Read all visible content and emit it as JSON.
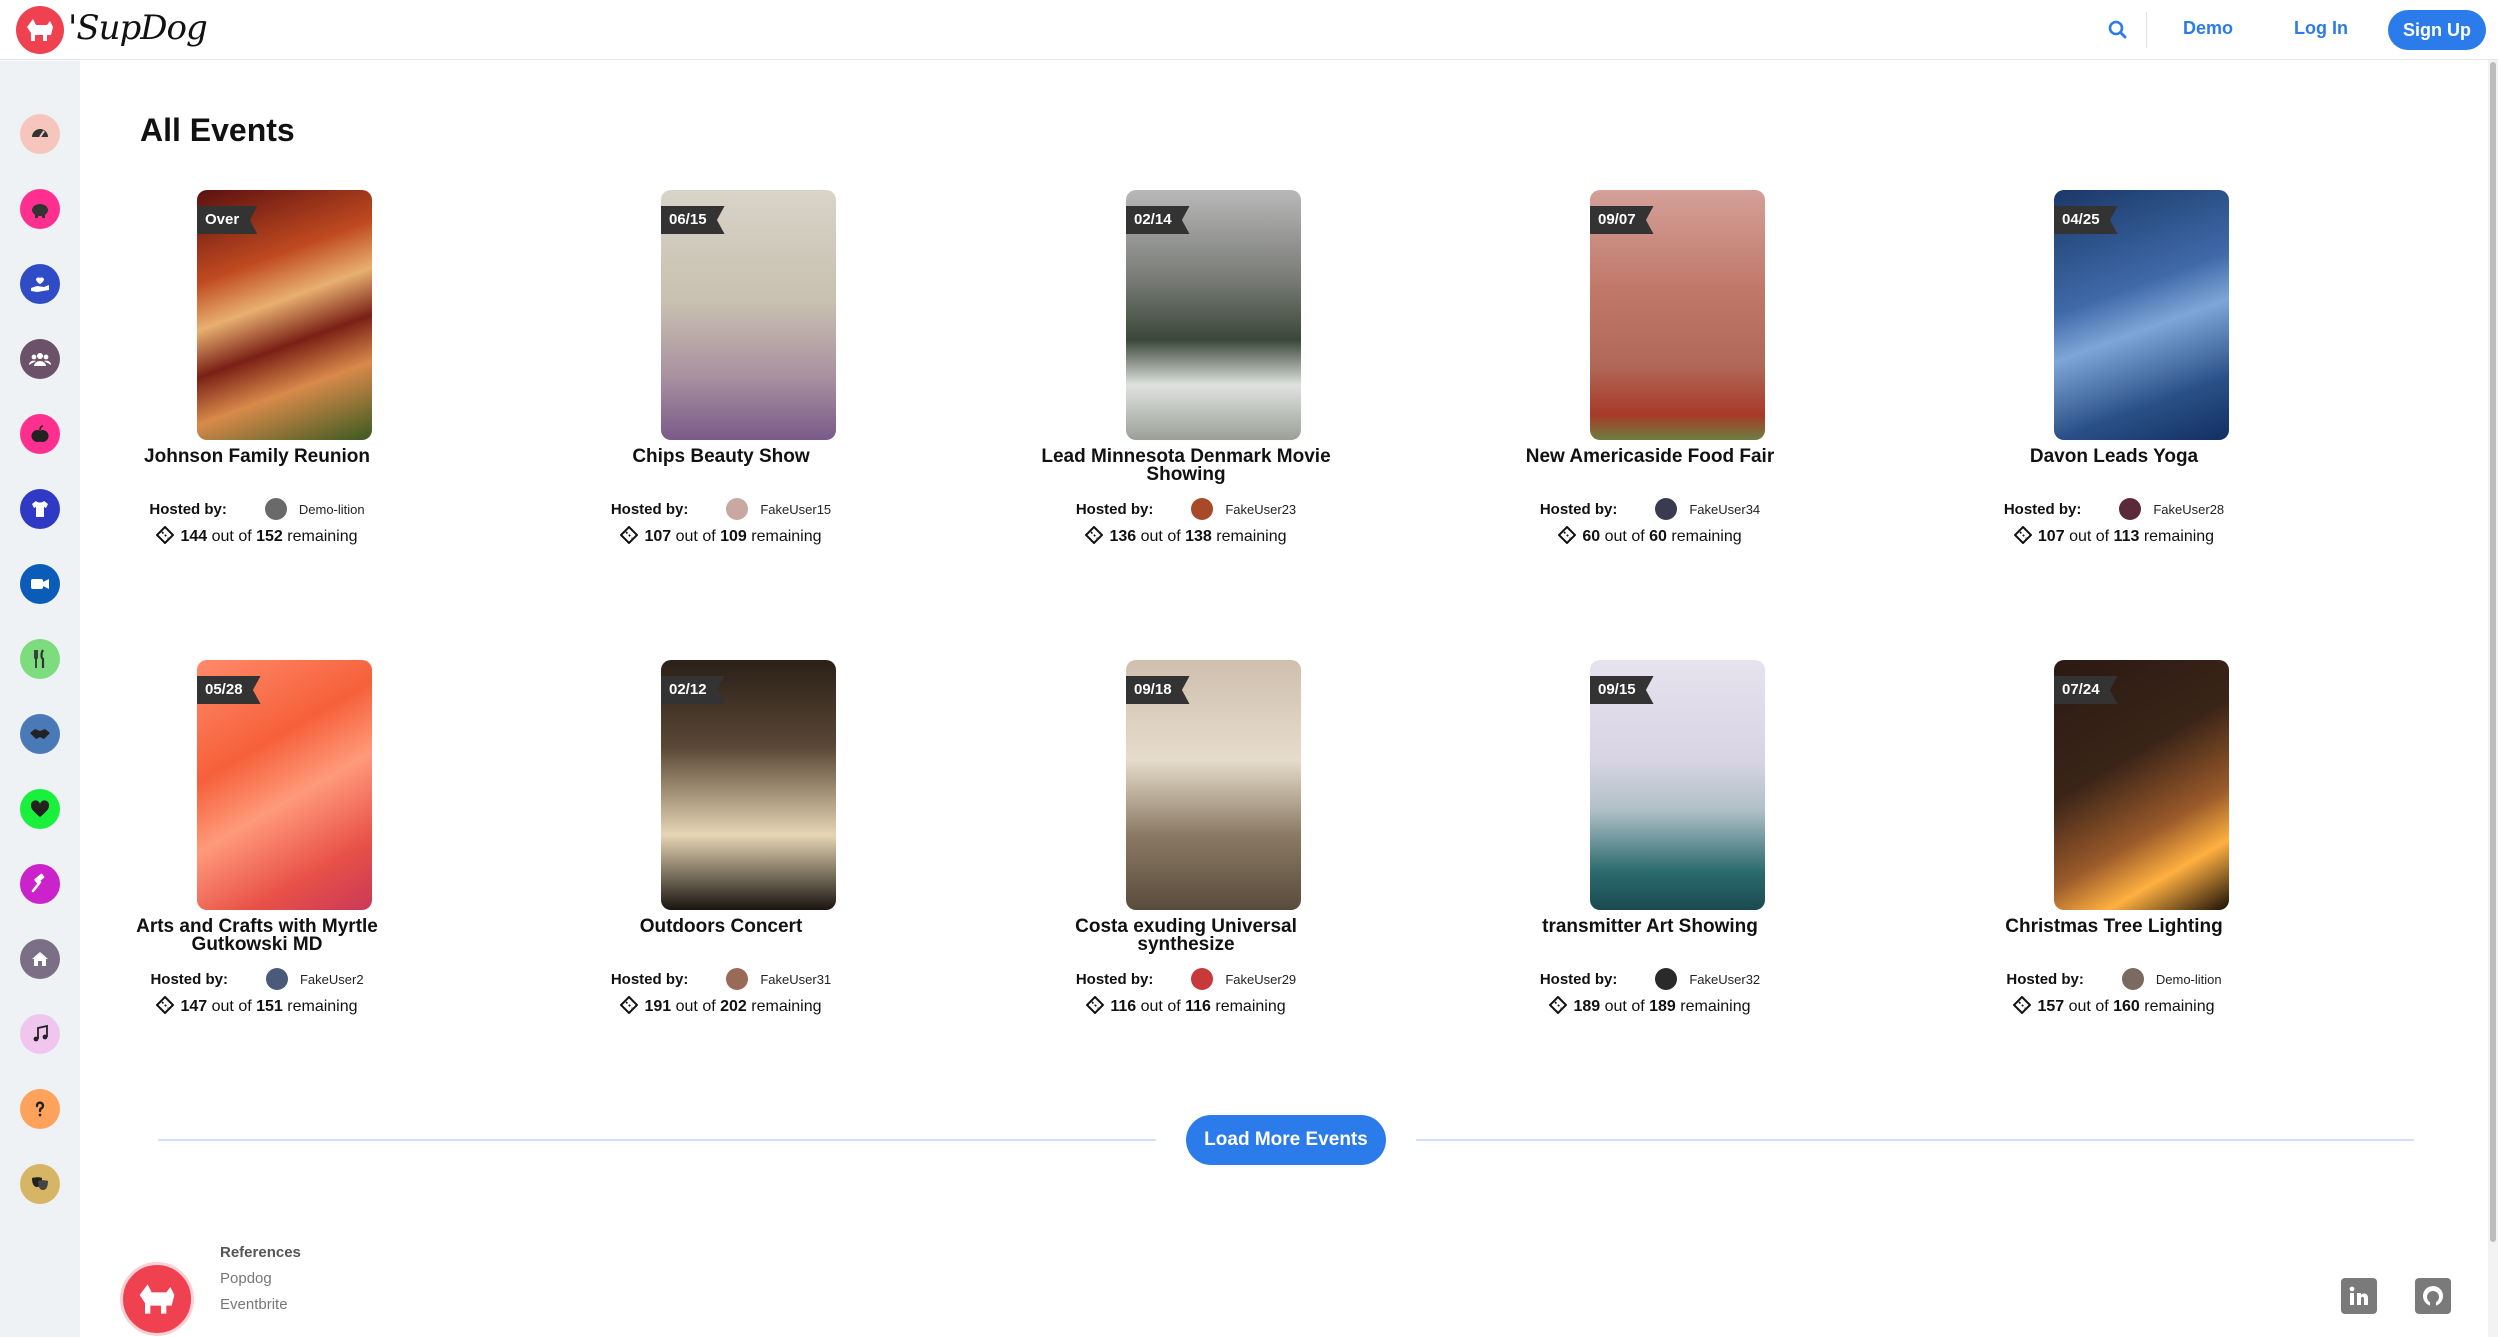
{
  "header": {
    "brand": "'SupDog",
    "nav": {
      "demo": "Demo",
      "login": "Log In",
      "signup": "Sign Up"
    }
  },
  "sidebar": {
    "items": [
      {
        "icon": "dashboard-icon",
        "color": "#f6c6bc"
      },
      {
        "icon": "piggy-bank-icon",
        "color": "#ff2f8f"
      },
      {
        "icon": "charity-hand-icon",
        "color": "#2f4cc6"
      },
      {
        "icon": "users-group-icon",
        "color": "#6c5268"
      },
      {
        "icon": "apple-icon",
        "color": "#ff2f8f"
      },
      {
        "icon": "tshirt-icon",
        "color": "#2f39c4"
      },
      {
        "icon": "video-camera-icon",
        "color": "#0a5cb8"
      },
      {
        "icon": "utensils-icon",
        "color": "#7ddc7d"
      },
      {
        "icon": "handshake-icon",
        "color": "#4a79b8"
      },
      {
        "icon": "heart-icon",
        "color": "#19f03c"
      },
      {
        "icon": "hammer-icon",
        "color": "#cc22cc"
      },
      {
        "icon": "home-icon",
        "color": "#7a6f85"
      },
      {
        "icon": "music-note-icon",
        "color": "#f1c6ee"
      },
      {
        "icon": "question-icon",
        "color": "#ffa25c"
      },
      {
        "icon": "theater-masks-icon",
        "color": "#d6b664"
      }
    ]
  },
  "main": {
    "title": "All Events",
    "hosted_label": "Hosted by:",
    "out_of": "out of",
    "remaining": "remaining",
    "load_more": "Load More Events"
  },
  "events": [
    {
      "badge": "Over",
      "title": "Johnson Family Reunion",
      "host": "Demo-lition",
      "avail": "144",
      "total": "152"
    },
    {
      "badge": "06/15",
      "title": "Chips Beauty Show",
      "host": "FakeUser15",
      "avail": "107",
      "total": "109"
    },
    {
      "badge": "02/14",
      "title": "Lead Minnesota Denmark Movie Showing",
      "host": "FakeUser23",
      "avail": "136",
      "total": "138"
    },
    {
      "badge": "09/07",
      "title": "New Americaside Food Fair",
      "host": "FakeUser34",
      "avail": "60",
      "total": "60"
    },
    {
      "badge": "04/25",
      "title": "Davon Leads Yoga",
      "host": "FakeUser28",
      "avail": "107",
      "total": "113"
    },
    {
      "badge": "05/28",
      "title": "Arts and Crafts with Myrtle Gutkowski MD",
      "host": "FakeUser2",
      "avail": "147",
      "total": "151"
    },
    {
      "badge": "02/12",
      "title": "Outdoors Concert",
      "host": "FakeUser31",
      "avail": "191",
      "total": "202"
    },
    {
      "badge": "09/18",
      "title": "Costa exuding Universal synthesize",
      "host": "FakeUser29",
      "avail": "116",
      "total": "116"
    },
    {
      "badge": "09/15",
      "title": "transmitter Art Showing",
      "host": "FakeUser32",
      "avail": "189",
      "total": "189"
    },
    {
      "badge": "07/24",
      "title": "Christmas Tree Lighting",
      "host": "Demo-lition",
      "avail": "157",
      "total": "160"
    }
  ],
  "footer": {
    "references_title": "References",
    "links": [
      "Popdog",
      "Eventbrite"
    ],
    "social": [
      "linkedin-icon",
      "github-icon"
    ]
  }
}
